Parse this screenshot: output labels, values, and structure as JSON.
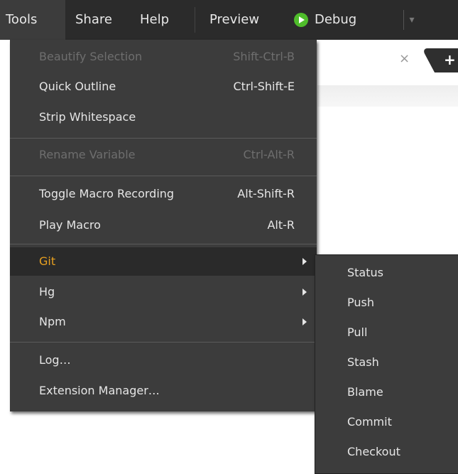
{
  "menubar": {
    "tools": "Tools",
    "share": "Share",
    "help": "Help",
    "preview": "Preview",
    "debug": "Debug",
    "debug_icon": "debug-play-icon",
    "dropdown_icon": "chevron-down-icon"
  },
  "editor": {
    "close_glyph": "×",
    "new_tab_glyph": "+"
  },
  "tools_menu": {
    "items": [
      {
        "label": "Beautify Selection",
        "shortcut": "Shift-Ctrl-B",
        "enabled": false
      },
      {
        "label": "Quick Outline",
        "shortcut": "Ctrl-Shift-E",
        "enabled": true
      },
      {
        "label": "Strip Whitespace",
        "shortcut": "",
        "enabled": true
      },
      {
        "label": "Rename Variable",
        "shortcut": "Ctrl-Alt-R",
        "enabled": false
      },
      {
        "label": "Toggle Macro Recording",
        "shortcut": "Alt-Shift-R",
        "enabled": true
      },
      {
        "label": "Play Macro",
        "shortcut": "Alt-R",
        "enabled": true
      },
      {
        "label": "Git",
        "shortcut": "",
        "enabled": true,
        "highlighted": true,
        "submenu": true
      },
      {
        "label": "Hg",
        "shortcut": "",
        "enabled": true,
        "submenu": true
      },
      {
        "label": "Npm",
        "shortcut": "",
        "enabled": true,
        "submenu": true
      },
      {
        "label": "Log…",
        "shortcut": "",
        "enabled": true
      },
      {
        "label": "Extension Manager…",
        "shortcut": "",
        "enabled": true
      }
    ]
  },
  "git_menu": {
    "items": [
      "Status",
      "Push",
      "Pull",
      "Stash",
      "Blame",
      "Commit",
      "Checkout"
    ]
  },
  "colors": {
    "menubar_bg": "#2b2b2b",
    "menu_bg": "#3c3c3c",
    "highlight_bg": "#2a2a2a",
    "highlight_text": "#e8a020",
    "disabled_text": "#6e6e6e",
    "debug_green": "#4fbd2b"
  }
}
